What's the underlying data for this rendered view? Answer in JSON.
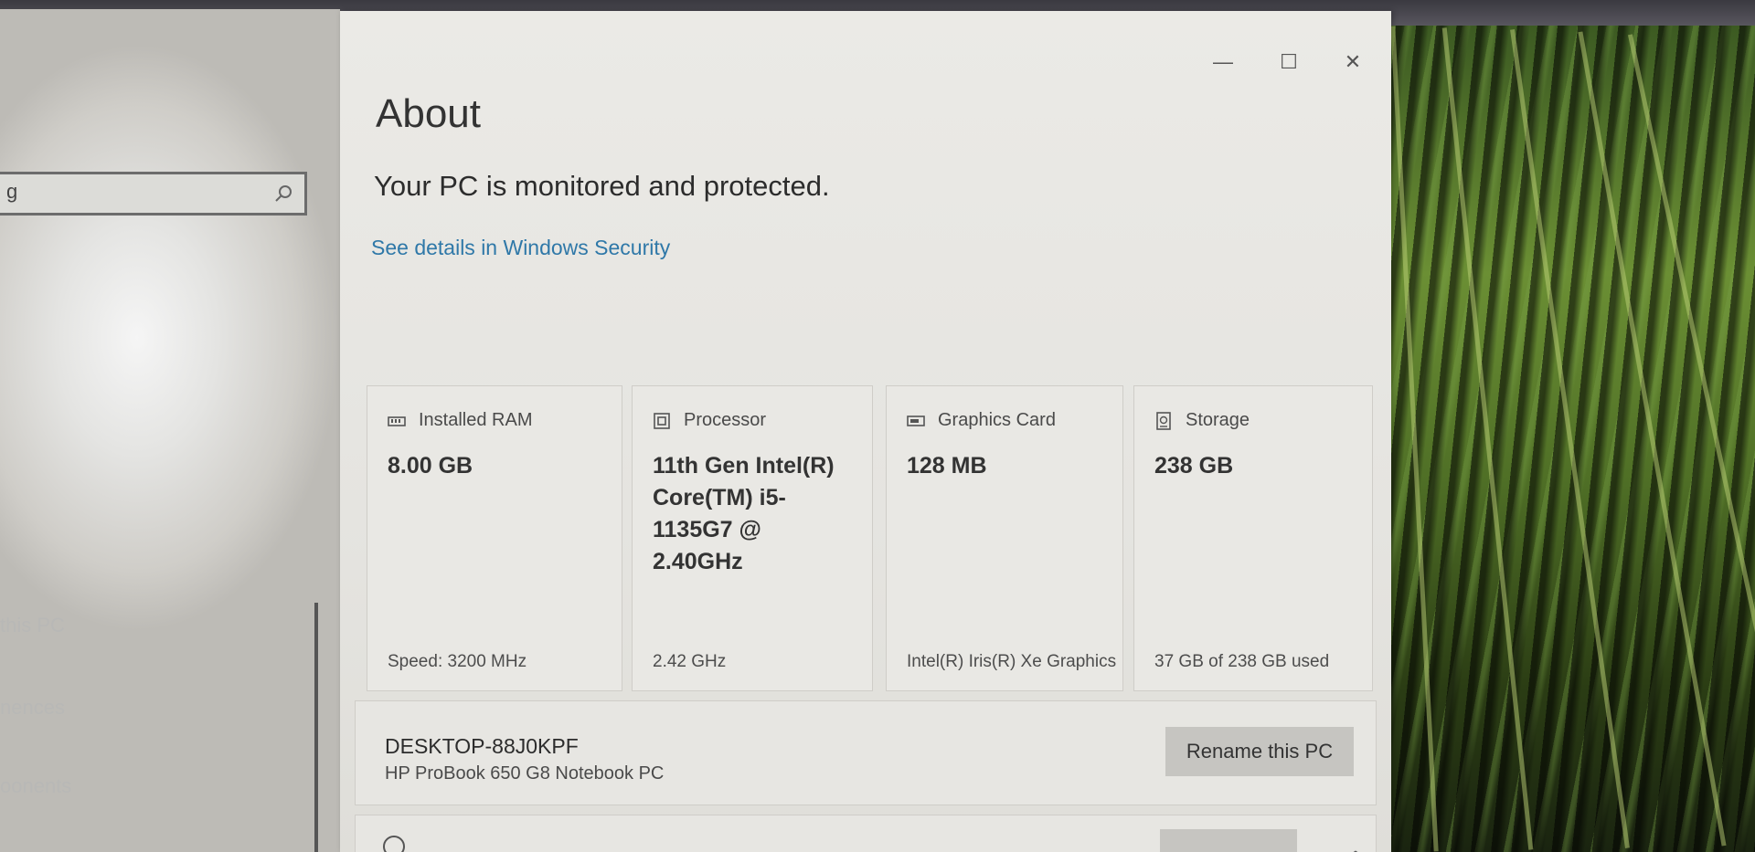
{
  "sidebar": {
    "search_value": "g",
    "items": [
      {
        "label": "this PC"
      },
      {
        "label": "nences"
      },
      {
        "label": "oonents"
      }
    ]
  },
  "window": {
    "minimize": "—",
    "maximize": "☐",
    "close": "✕"
  },
  "page": {
    "title": "About",
    "protection_status": "Your PC is monitored and protected.",
    "security_link": "See details in Windows Security"
  },
  "specs": [
    {
      "icon": "ram-icon",
      "label": "Installed RAM",
      "value": "8.00 GB",
      "detail": "Speed: 3200 MHz"
    },
    {
      "icon": "processor-icon",
      "label": "Processor",
      "value": "11th Gen Intel(R) Core(TM) i5-1135G7 @ 2.40GHz",
      "detail": "2.42 GHz"
    },
    {
      "icon": "graphics-card-icon",
      "label": "Graphics Card",
      "value": "128 MB",
      "detail": "Intel(R) Iris(R) Xe Graphics"
    },
    {
      "icon": "storage-icon",
      "label": "Storage",
      "value": "238 GB",
      "detail": "37 GB of 238 GB used"
    }
  ],
  "device": {
    "name": "DESKTOP-88J0KPF",
    "model": "HP ProBook 650 G8 Notebook PC",
    "rename_label": "Rename this PC"
  },
  "colors": {
    "link": "#2f78a8",
    "window_bg": "#e5e4e0",
    "button_bg": "#c6c5c1"
  }
}
